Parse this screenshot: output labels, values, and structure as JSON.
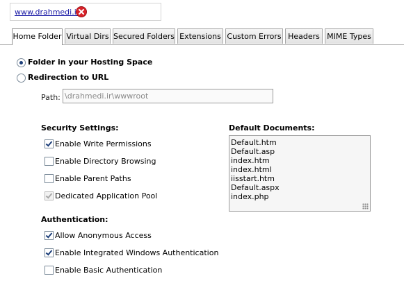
{
  "site": {
    "url": "www.drahmedi.ir"
  },
  "tabs": [
    {
      "label": "Home Folder",
      "active": true
    },
    {
      "label": "Virtual Dirs",
      "active": false
    },
    {
      "label": "Secured Folders",
      "active": false
    },
    {
      "label": "Extensions",
      "active": false
    },
    {
      "label": "Custom Errors",
      "active": false
    },
    {
      "label": "Headers",
      "active": false
    },
    {
      "label": "MIME Types",
      "active": false
    }
  ],
  "home_folder": {
    "option_folder": "Folder in your Hosting Space",
    "option_folder_selected": true,
    "option_redirect": "Redirection to URL",
    "option_redirect_selected": false,
    "path_label": "Path:",
    "path_value": "\\drahmedi.ir\\wwwroot"
  },
  "security": {
    "title": "Security Settings:",
    "items": [
      {
        "label": "Enable Write Permissions",
        "checked": true,
        "disabled": false
      },
      {
        "label": "Enable Directory Browsing",
        "checked": false,
        "disabled": false
      },
      {
        "label": "Enable Parent Paths",
        "checked": false,
        "disabled": false
      },
      {
        "label": "Dedicated Application Pool",
        "checked": true,
        "disabled": true
      }
    ]
  },
  "authentication": {
    "title": "Authentication:",
    "items": [
      {
        "label": "Allow Anonymous Access",
        "checked": true
      },
      {
        "label": "Enable Integrated Windows Authentication",
        "checked": true
      },
      {
        "label": "Enable Basic Authentication",
        "checked": false
      }
    ]
  },
  "default_documents": {
    "title": "Default Documents:",
    "items": [
      "Default.htm",
      "Default.asp",
      "index.htm",
      "index.html",
      "iisstart.htm",
      "Default.aspx",
      "index.php"
    ]
  },
  "colors": {
    "link": "#1a1aa6",
    "remove_icon": "#d8232a",
    "tab_border": "#a8a8a8"
  },
  "icons": {
    "remove": "close-circle-icon",
    "grip": "resize-grip-icon"
  }
}
